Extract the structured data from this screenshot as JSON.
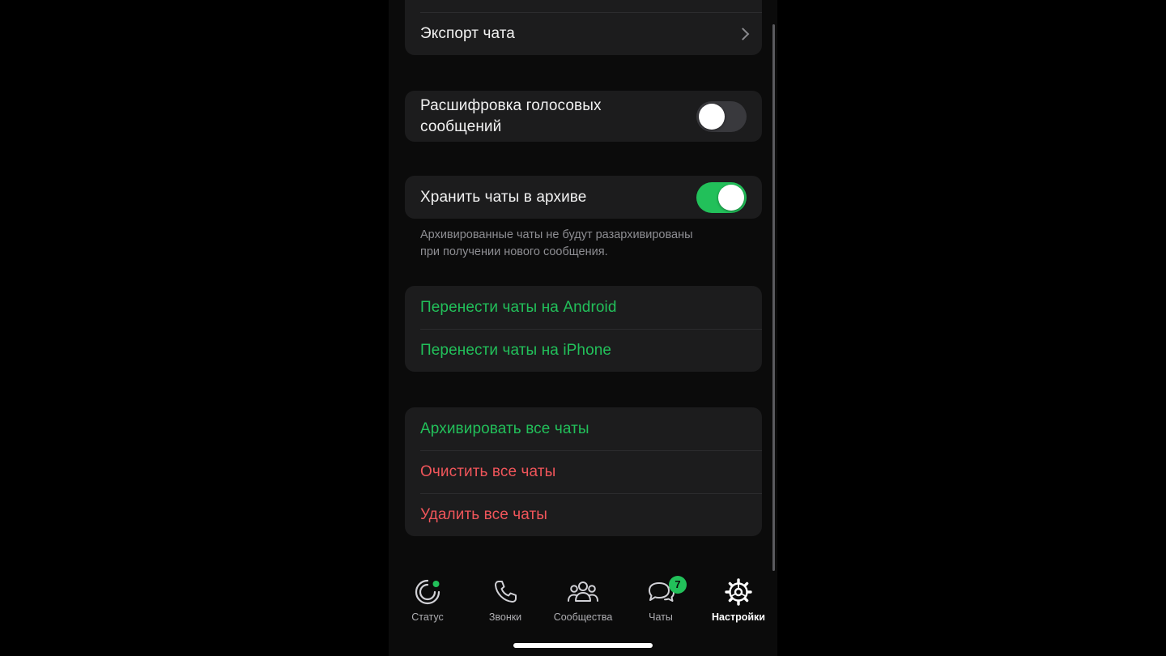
{
  "groups": {
    "export": {
      "label": "Экспорт чата"
    },
    "transcription": {
      "label_line1": "Расшифровка голосовых",
      "label_line2": "сообщений",
      "enabled": false
    },
    "archive": {
      "label": "Хранить чаты в архиве",
      "enabled": true,
      "footnote_line1": "Архивированные чаты не будут разархивированы",
      "footnote_line2": "при получении нового сообщения."
    },
    "transfer": {
      "android_label": "Перенести чаты на Android",
      "iphone_label": "Перенести чаты на iPhone"
    },
    "danger": {
      "archive_all_label": "Архивировать все чаты",
      "clear_all_label": "Очистить все чаты",
      "delete_all_label": "Удалить все чаты"
    }
  },
  "tabbar": {
    "status": "Статус",
    "calls": "Звонки",
    "communities": "Сообщества",
    "chats": "Чаты",
    "chats_badge": "7",
    "settings": "Настройки",
    "active": "settings"
  },
  "colors": {
    "accent_green": "#22c05a",
    "destructive_red": "#f0555a",
    "group_bg": "#1c1c1d",
    "page_bg": "#0b0b0b"
  },
  "icons": {
    "status": "status-ring-icon",
    "calls": "phone-icon",
    "communities": "people-group-icon",
    "chats": "chat-bubbles-icon",
    "settings": "gear-icon",
    "chevron": "chevron-right-icon"
  }
}
